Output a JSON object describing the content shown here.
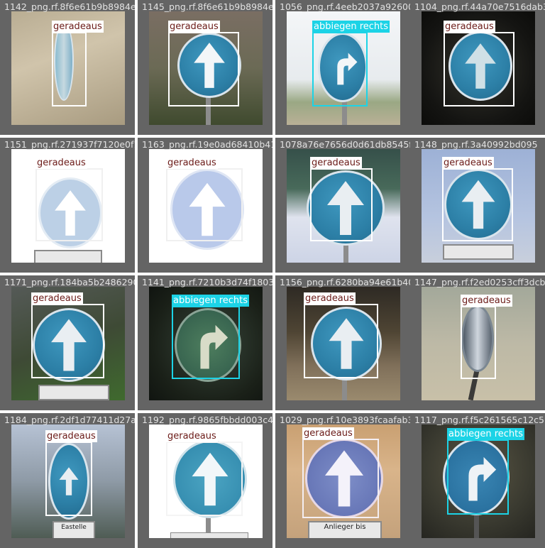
{
  "colors": {
    "frame": "#646464",
    "divider": "#ffffff",
    "label_geradeaus": "#ffffff",
    "label_abbiegen": "#1cd3e6"
  },
  "cells": [
    {
      "filename": "1142_png.rf.8f6e61b9b8984e33f0f04f1fc55b447bba66",
      "label": "geradeaus",
      "sign": "straight-arrow-sign"
    },
    {
      "filename": "1145_png.rf.8f6e61b9b8984e33f0f04f1fc55b447bba663b",
      "label": "geradeaus",
      "sign": "straight-arrow-sign"
    },
    {
      "filename": "1056_png.rf.4eeb2037a92600a64184_png.rf.4e",
      "label": "abbiegen rechts",
      "sign": "turn-right-sign"
    },
    {
      "filename": "1104_png.rf.44a70e7516dab377",
      "label": "geradeaus",
      "sign": "straight-arrow-sign"
    },
    {
      "filename": "1151_png.rf.271937f7120e0f188f8ffcff9d0ad68410b41",
      "label": "geradeaus",
      "sign": "straight-arrow-sign"
    },
    {
      "filename": "1163_png.rf.19e0ad68410b41e07",
      "label": "geradeaus",
      "sign": "straight-arrow-sign"
    },
    {
      "filename": "1078a76e7656d0d61db8545f",
      "label": "geradeaus",
      "sign": "straight-arrow-sign"
    },
    {
      "filename": "1148_png.rf.3a40992bd095",
      "label": "geradeaus",
      "sign": "straight-arrow-sign"
    },
    {
      "filename": "1171_png.rf.184ba5b2486290f1",
      "label": "geradeaus",
      "sign": "straight-arrow-sign"
    },
    {
      "filename": "1141_png.rf.7210b3d74f1803fe3a9",
      "label": "abbiegen rechts",
      "sign": "turn-right-sign"
    },
    {
      "filename": "1156_png.rf.6280ba94e61b401",
      "label": "geradeaus",
      "sign": "straight-arrow-sign"
    },
    {
      "filename": "1147_png.rf.f2ed0253cff3dcb",
      "label": "geradeaus",
      "sign": "straight-arrow-sign"
    },
    {
      "filename": "1184_png.rf.2df1d77411d27a8",
      "label": "geradeaus",
      "sign": "straight-arrow-sign"
    },
    {
      "filename": "1192_png.rf.9865fbbdd003c4295",
      "label": "geradeaus",
      "sign": "straight-arrow-sign"
    },
    {
      "filename": "1029_png.rf.10e3893fcaafab3",
      "label": "geradeaus",
      "sign": "straight-arrow-sign"
    },
    {
      "filename": "1117_png.rf.f5c261565c12c5",
      "label": "abbiegen rechts",
      "sign": "turn-right-sign"
    }
  ],
  "plates": {
    "p13": "Eastelle",
    "p15": "Anlieger bis"
  }
}
